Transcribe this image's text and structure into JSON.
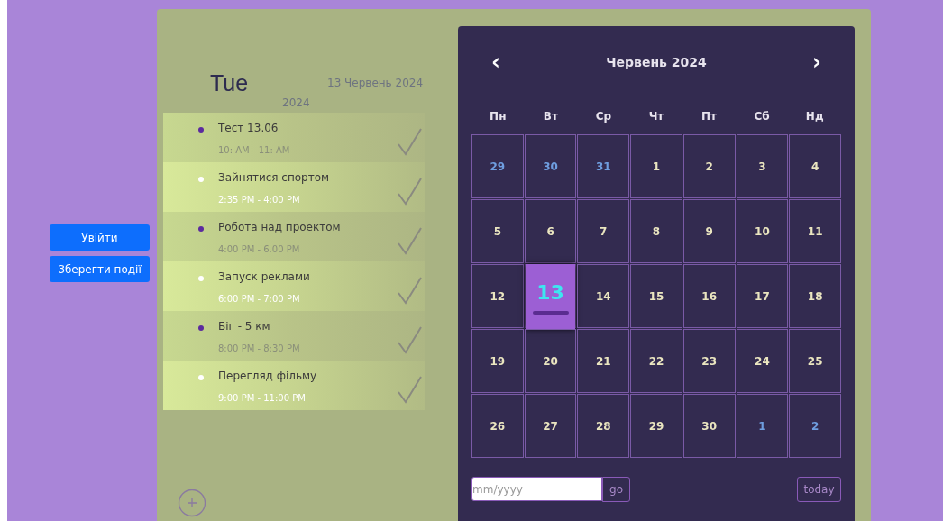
{
  "auth_buttons": [
    "Увійти",
    "Зберегти події"
  ],
  "day_header": {
    "weekday": "Tue",
    "date": "13 Червень 2024",
    "year": "2024"
  },
  "events": [
    {
      "title": "Тест 13.06",
      "time": "10: AM - 11: AM",
      "color": "#5b2a9e"
    },
    {
      "title": "Зайнятися спортом",
      "time": "2:35 PM - 4:00 PM",
      "color": "#ffffff"
    },
    {
      "title": "Робота над проектом",
      "time": "4:00 PM - 6.00 PM",
      "color": "#5b2a9e"
    },
    {
      "title": "Запуск реклами",
      "time": "6:00 PM - 7:00 PM",
      "color": "#ffffff"
    },
    {
      "title": "Біг - 5 км",
      "time": "8:00 PM - 8:30 PM",
      "color": "#5b2a9e"
    },
    {
      "title": "Перегляд фільму",
      "time": "9:00 PM - 11:00 PM",
      "color": "#ffffff"
    }
  ],
  "calendar": {
    "prev": "‹",
    "month": "Червень 2024",
    "next": "›",
    "weekdays": [
      "Пн",
      "Вт",
      "Ср",
      "Чт",
      "Пт",
      "Сб",
      "Нд"
    ],
    "days": [
      {
        "label": "29",
        "kind": "other",
        "selected": false
      },
      {
        "label": "30",
        "kind": "other",
        "selected": false
      },
      {
        "label": "31",
        "kind": "other",
        "selected": false
      },
      {
        "label": "1",
        "kind": "current",
        "selected": false
      },
      {
        "label": "2",
        "kind": "current",
        "selected": false
      },
      {
        "label": "3",
        "kind": "current",
        "selected": false
      },
      {
        "label": "4",
        "kind": "current",
        "selected": false
      },
      {
        "label": "5",
        "kind": "current",
        "selected": false
      },
      {
        "label": "6",
        "kind": "current",
        "selected": false
      },
      {
        "label": "7",
        "kind": "current",
        "selected": false
      },
      {
        "label": "8",
        "kind": "current",
        "selected": false
      },
      {
        "label": "9",
        "kind": "current",
        "selected": false
      },
      {
        "label": "10",
        "kind": "current",
        "selected": false
      },
      {
        "label": "11",
        "kind": "current",
        "selected": false
      },
      {
        "label": "12",
        "kind": "current",
        "selected": false
      },
      {
        "label": "13",
        "kind": "current",
        "selected": true
      },
      {
        "label": "14",
        "kind": "current",
        "selected": false
      },
      {
        "label": "15",
        "kind": "current",
        "selected": false
      },
      {
        "label": "16",
        "kind": "current",
        "selected": false
      },
      {
        "label": "17",
        "kind": "current",
        "selected": false
      },
      {
        "label": "18",
        "kind": "current",
        "selected": false
      },
      {
        "label": "19",
        "kind": "current",
        "selected": false
      },
      {
        "label": "20",
        "kind": "current",
        "selected": false
      },
      {
        "label": "21",
        "kind": "current",
        "selected": false
      },
      {
        "label": "22",
        "kind": "current",
        "selected": false
      },
      {
        "label": "23",
        "kind": "current",
        "selected": false
      },
      {
        "label": "24",
        "kind": "current",
        "selected": false
      },
      {
        "label": "25",
        "kind": "current",
        "selected": false
      },
      {
        "label": "26",
        "kind": "current",
        "selected": false
      },
      {
        "label": "27",
        "kind": "current",
        "selected": false
      },
      {
        "label": "28",
        "kind": "current",
        "selected": false
      },
      {
        "label": "29",
        "kind": "current",
        "selected": false
      },
      {
        "label": "30",
        "kind": "current",
        "selected": false
      },
      {
        "label": "1",
        "kind": "other",
        "selected": false
      },
      {
        "label": "2",
        "kind": "other",
        "selected": false
      }
    ],
    "month_field": {
      "placeholder": "mm/yyyy"
    },
    "go": "go",
    "today": "today"
  }
}
